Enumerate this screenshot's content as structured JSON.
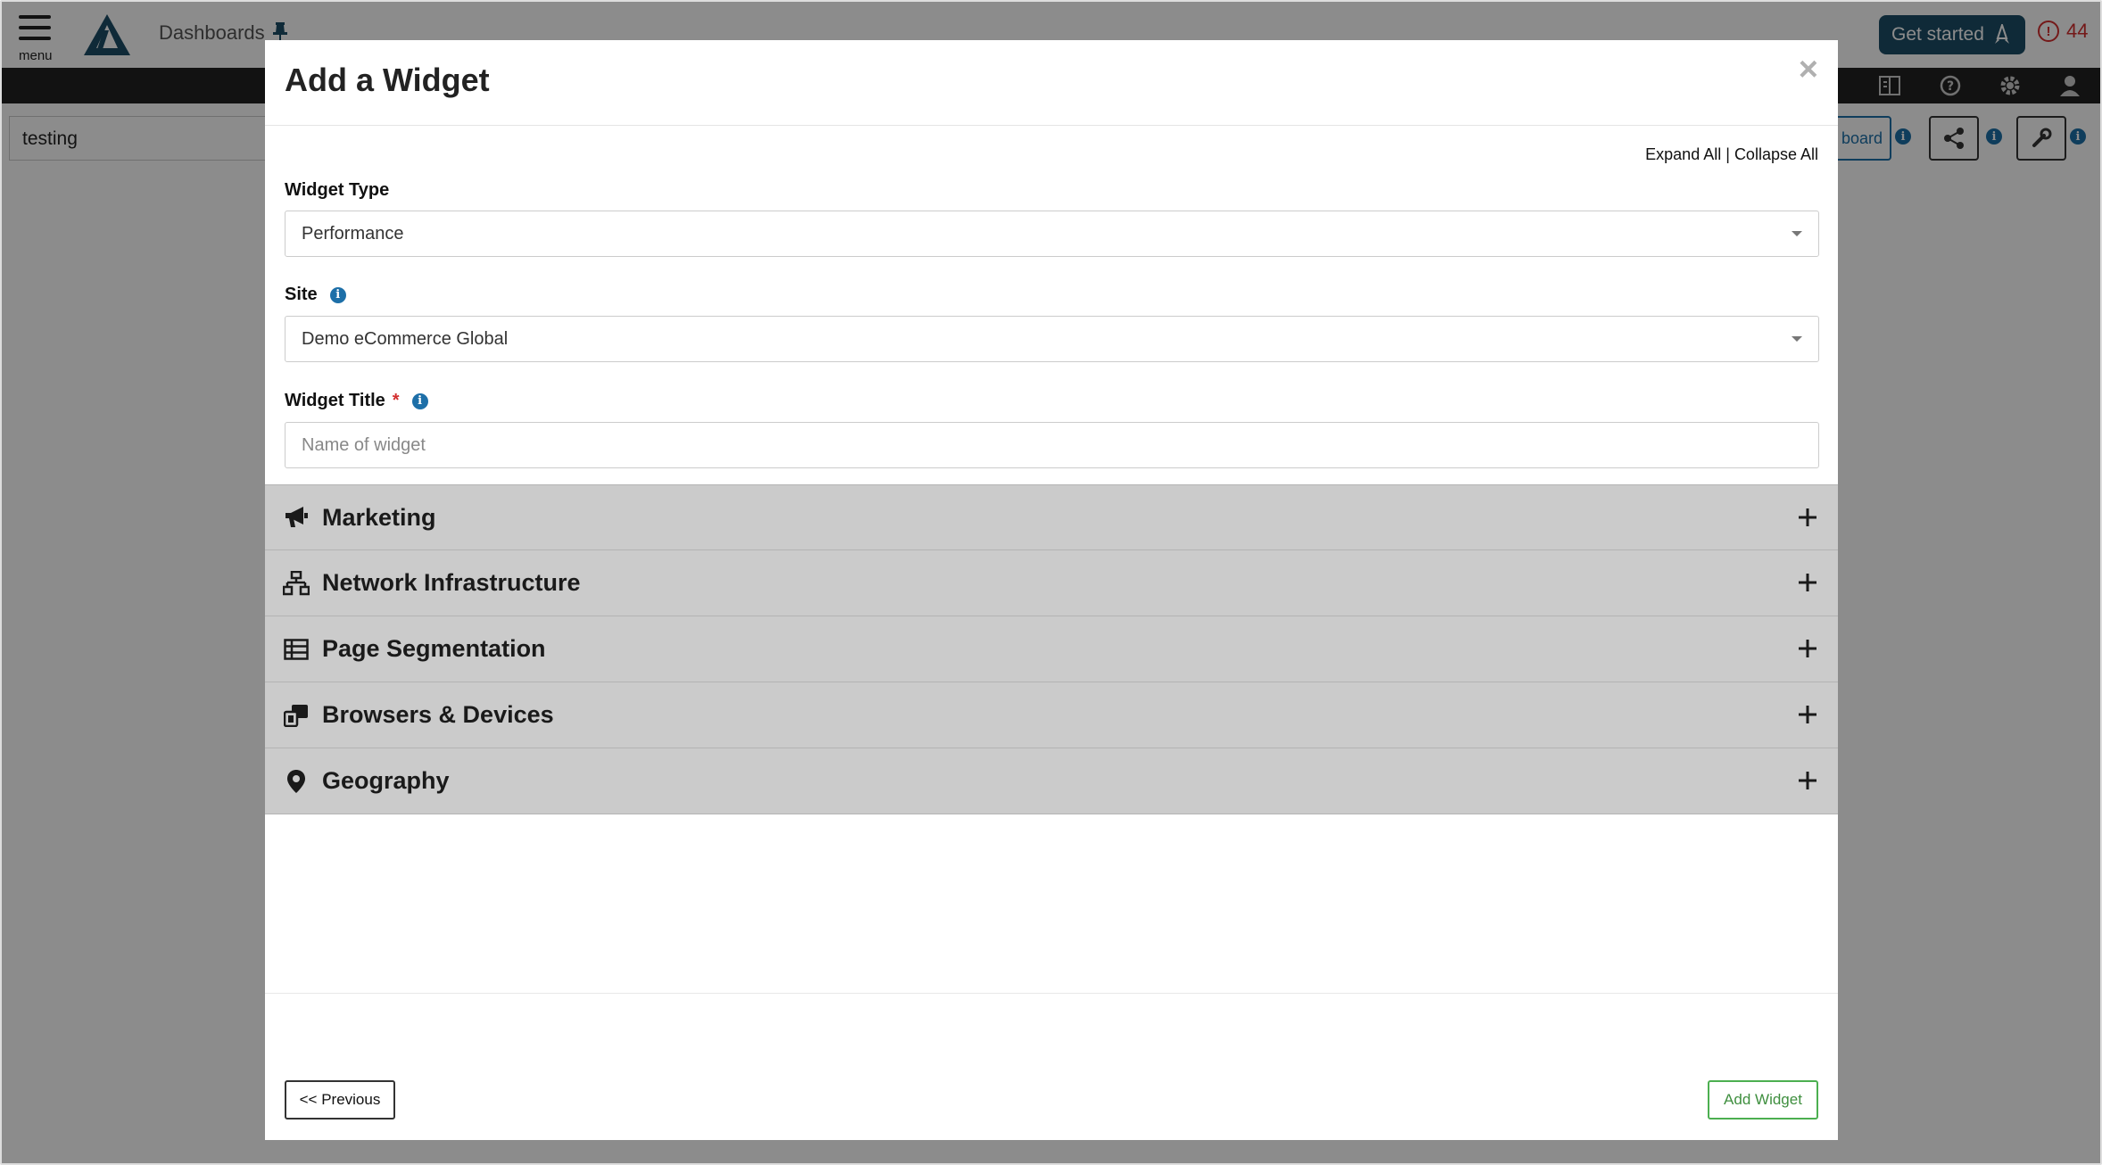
{
  "app": {
    "menu_label": "menu",
    "nav_link": "Dashboards",
    "get_started": "Get started",
    "alert_count": "44",
    "dashboard_name": "testing",
    "board_button_partial": "board"
  },
  "modal": {
    "title": "Add a Widget",
    "close": "×",
    "expand_all": "Expand All",
    "separator": "|",
    "collapse_all": "Collapse All",
    "widget_type": {
      "label": "Widget Type",
      "value": "Performance"
    },
    "site": {
      "label": "Site",
      "value": "Demo eCommerce Global"
    },
    "widget_title": {
      "label": "Widget Title",
      "required_mark": "*",
      "placeholder": "Name of widget"
    },
    "sections": [
      {
        "label": "Marketing",
        "icon": "megaphone-icon"
      },
      {
        "label": "Network Infrastructure",
        "icon": "network-icon"
      },
      {
        "label": "Page Segmentation",
        "icon": "table-list-icon"
      },
      {
        "label": "Browsers & Devices",
        "icon": "devices-icon"
      },
      {
        "label": "Geography",
        "icon": "map-marker-icon"
      }
    ],
    "previous_button": "<< Previous",
    "add_button": "Add Widget"
  },
  "colors": {
    "brand": "#1d4e66",
    "alert": "#d32f2f",
    "info": "#1d6fa8",
    "add_button": "#4caf50",
    "section_bg": "#cbcbcb"
  }
}
